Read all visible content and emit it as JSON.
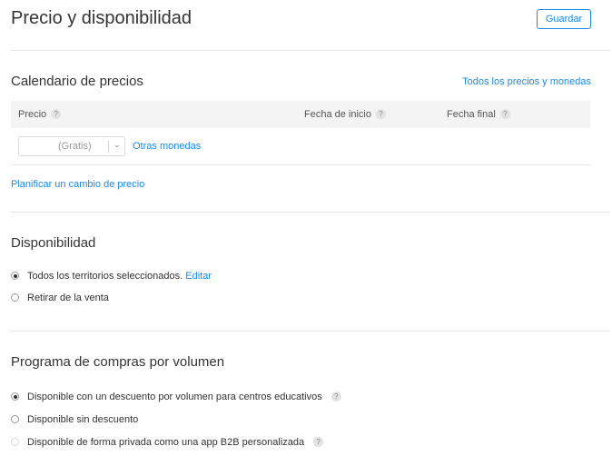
{
  "header": {
    "title": "Precio y disponibilidad",
    "save_label": "Guardar"
  },
  "pricing": {
    "title": "Calendario de precios",
    "all_prices_link": "Todos los precios y monedas",
    "columns": {
      "price": "Precio",
      "start_date": "Fecha de inicio",
      "end_date": "Fecha final"
    },
    "help_glyph": "?",
    "price_value": "(Gratis)",
    "other_currencies_link": "Otras monedas",
    "plan_change_link": "Planificar un cambio de precio"
  },
  "availability": {
    "title": "Disponibilidad",
    "option_all": "Todos los territorios seleccionados.",
    "edit_link": "Editar",
    "option_remove": "Retirar de la venta",
    "selected": "all"
  },
  "volume": {
    "title": "Programa de compras por volumen",
    "options": [
      {
        "label": "Disponible con un descuento por volumen para centros educativos",
        "checked": true,
        "help": true
      },
      {
        "label": "Disponible sin descuento",
        "checked": false,
        "help": false
      },
      {
        "label": "Disponible de forma privada como una app B2B personalizada",
        "checked": false,
        "help": true,
        "faded": true
      }
    ]
  },
  "colors": {
    "accent": "#1d89e4",
    "divider": "#e6e6e6",
    "header_bg": "#f4f4f4"
  },
  "icons": {
    "help": "question-circle-icon",
    "dropdown": "chevron-down-icon",
    "radio": "radio-icon"
  }
}
